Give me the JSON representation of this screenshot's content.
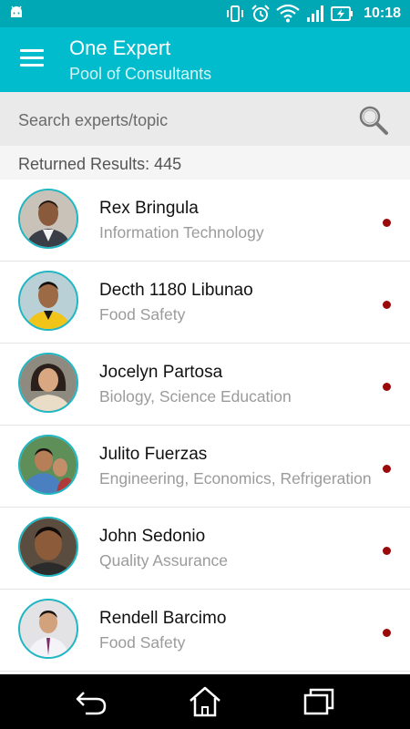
{
  "status_bar": {
    "time": "10:18",
    "icons": [
      "android-icon",
      "vibrate-icon",
      "alarm-icon",
      "wifi-icon",
      "signal-icon",
      "battery-charging-icon"
    ]
  },
  "app_bar": {
    "title": "One Expert",
    "subtitle": "Pool of Consultants",
    "menu_icon": "hamburger-menu-icon"
  },
  "search": {
    "placeholder": "Search experts/topic",
    "icon": "search-icon"
  },
  "results": {
    "label": "Returned Results: 445"
  },
  "experts": [
    {
      "name": "Rex Bringula",
      "topic": "Information Technology"
    },
    {
      "name": "Decth 1180 Libunao",
      "topic": "Food Safety"
    },
    {
      "name": "Jocelyn Partosa",
      "topic": "Biology, Science Education"
    },
    {
      "name": "Julito Fuerzas",
      "topic": "Engineering, Economics, Refrigeration"
    },
    {
      "name": "John Sedonio",
      "topic": "Quality Assurance"
    },
    {
      "name": "Rendell Barcimo",
      "topic": "Food Safety"
    }
  ],
  "colors": {
    "primary": "#00bccd",
    "primary_dark": "#00a7b5",
    "status_dot": "#9b0a0a",
    "avatar_ring": "#1fb7c4"
  },
  "nav_bar": {
    "icons": [
      "back-icon",
      "home-icon",
      "recent-apps-icon"
    ]
  }
}
